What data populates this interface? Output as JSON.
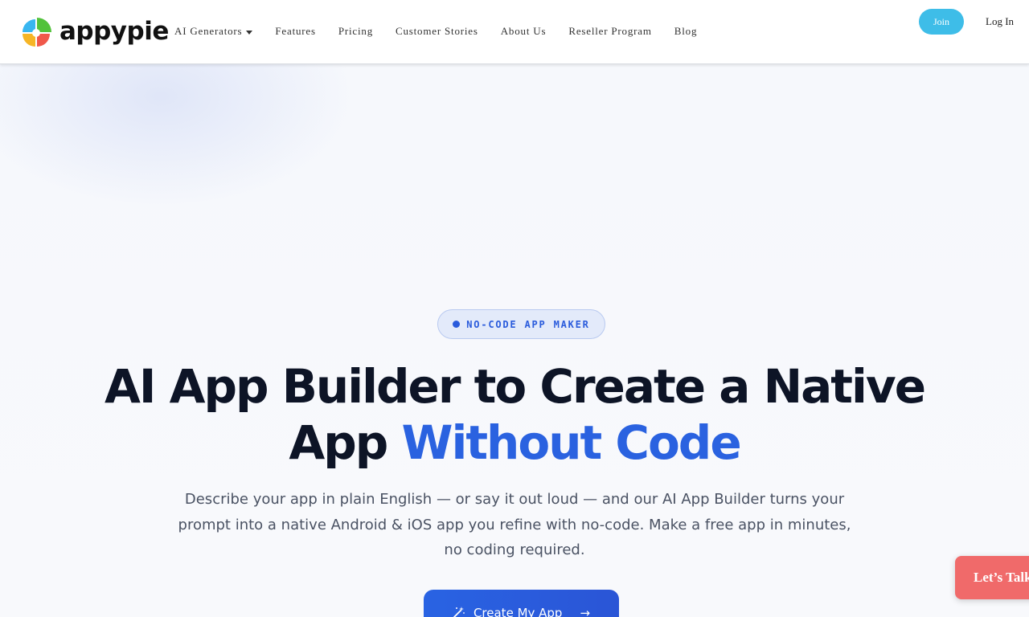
{
  "brand": {
    "name": "appypie"
  },
  "nav": {
    "items": [
      {
        "label": "AI Generators",
        "has_dropdown": true
      },
      {
        "label": "Features"
      },
      {
        "label": "Pricing"
      },
      {
        "label": "Customer Stories"
      },
      {
        "label": "About Us"
      },
      {
        "label": "Reseller Program"
      },
      {
        "label": "Blog"
      }
    ],
    "join_label": "Join",
    "login_label": "Log In"
  },
  "hero": {
    "badge": "NO-CODE APP MAKER",
    "headline_part1": "AI App Builder to Create a Native App",
    "headline_accent": "Without Code",
    "subtext": "Describe your app in plain English — or say it out loud — and our AI App Builder turns your prompt into a native Android & iOS app you refine with no-code. Make a free app in minutes, no coding required.",
    "cta_label": "Create My App",
    "cta_icon": "magic-wand-icon"
  },
  "chat": {
    "label": "Let’s Talk"
  },
  "colors": {
    "accent": "#2a62e0",
    "join_button": "#3ebde8",
    "talk_button": "#f06a6a",
    "headline": "#0d1426"
  }
}
